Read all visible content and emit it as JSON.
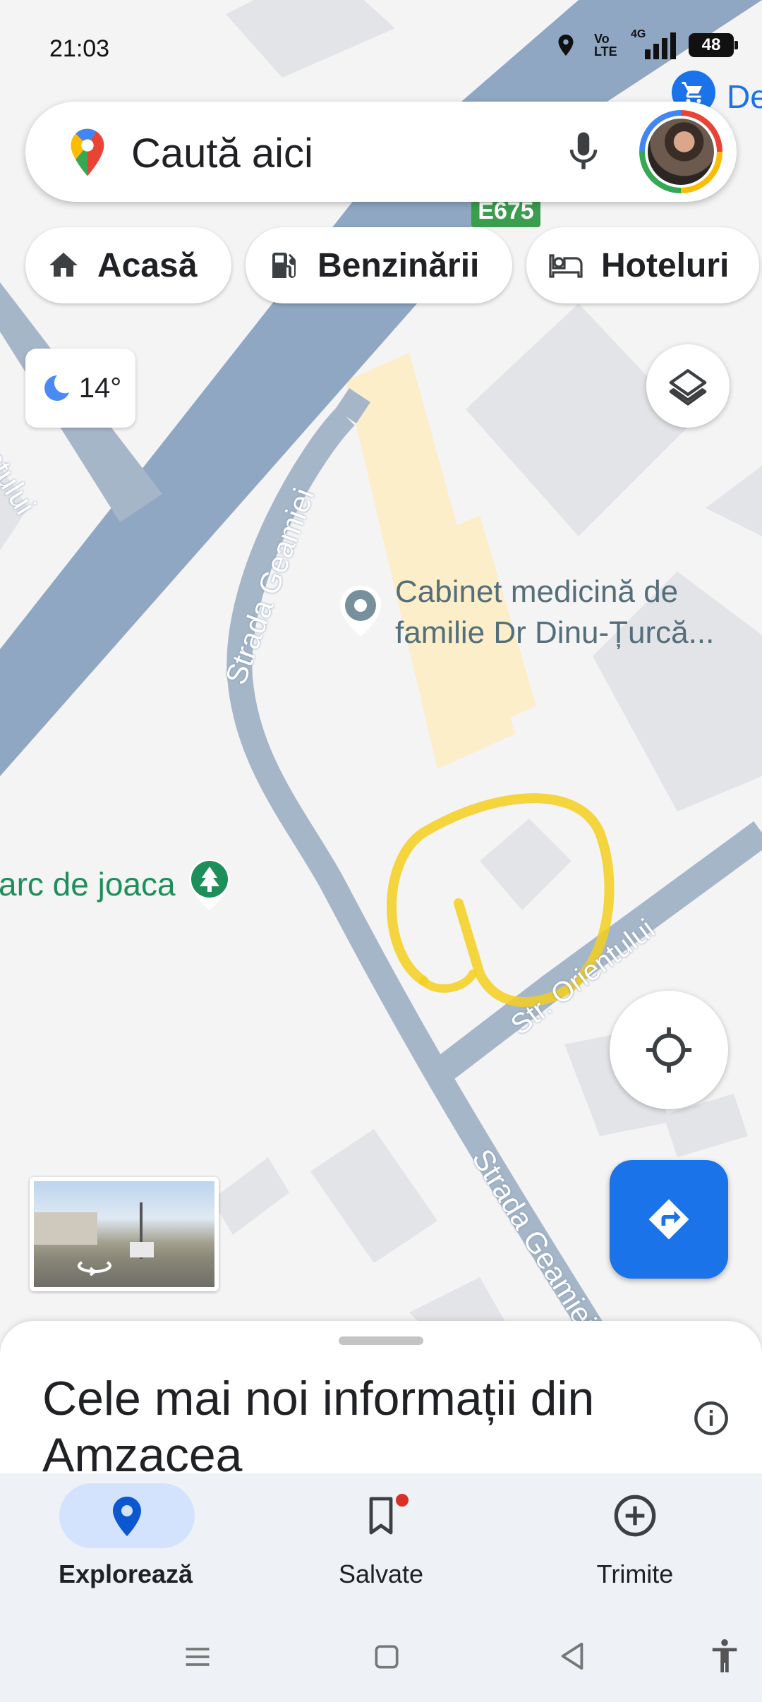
{
  "status_bar": {
    "time": "21:03",
    "battery": "48",
    "network": "4G",
    "volte": "Vo LTE"
  },
  "search": {
    "placeholder": "Caută aici"
  },
  "chips": [
    {
      "label": "Acasă",
      "icon": "home-icon"
    },
    {
      "label": "Benzinării",
      "icon": "gas-station-icon"
    },
    {
      "label": "Hoteluri",
      "icon": "hotel-bed-icon"
    }
  ],
  "weather": {
    "temperature": "14°",
    "icon": "moon-icon"
  },
  "map": {
    "road_badge": "E675",
    "top_right_poi": "De",
    "place_name_line1": "Cabinet medicină de",
    "place_name_line2": "familie Dr Dinu-Țurcă...",
    "park_label": "arc de joaca",
    "street_orientului_upper": "ıe Orientului",
    "street_geamiei_upper": "Strada Geamiei",
    "street_orientului_lower": "Str. Orientului",
    "street_geamiei_lower": "Strada Geamiei",
    "colors": {
      "road": "#8fa7c2",
      "minor_road": "#a6b6c9",
      "building": "#e3e4e8",
      "poi_highlight": "#fbeec8",
      "park_green": "#1e8e5a",
      "annotation": "#f5cf1d"
    }
  },
  "bottom_sheet": {
    "title": "Cele mai noi informații din Amzacea"
  },
  "bottom_nav": {
    "items": [
      {
        "label": "Explorează",
        "icon": "location-pin-icon",
        "active": true
      },
      {
        "label": "Salvate",
        "icon": "bookmark-icon",
        "active": false
      },
      {
        "label": "Trimite",
        "icon": "add-circle-icon",
        "active": false
      }
    ]
  },
  "accent_color": "#1a73e8"
}
